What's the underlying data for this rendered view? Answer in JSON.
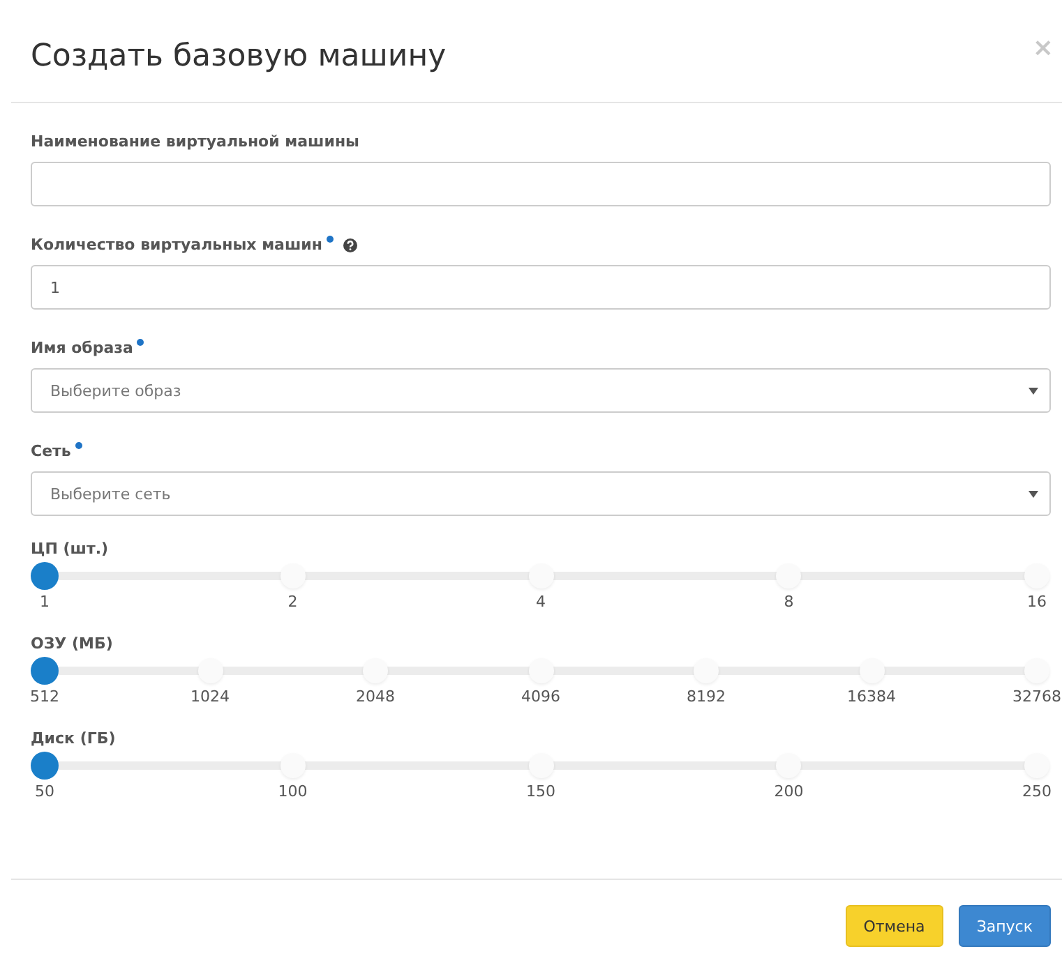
{
  "dialog": {
    "title": "Создать базовую машину",
    "close": "×"
  },
  "fields": [
    {
      "kind": "text",
      "label": "Наименование виртуальной машины",
      "required": false,
      "help": false
    },
    {
      "kind": "text",
      "label": "Количество виртуальных машин",
      "required": true,
      "help": true,
      "value": "1"
    },
    {
      "kind": "select",
      "label": "Имя образа",
      "required": true,
      "help": false,
      "placeholder": "Выберите образ"
    },
    {
      "kind": "select",
      "label": "Сеть",
      "required": true,
      "help": false,
      "placeholder": "Выберите сеть"
    }
  ],
  "sliders": [
    {
      "label": "ЦП (шт.)",
      "level": 0,
      "ticks": [
        "1",
        "2",
        "4",
        "8",
        "16"
      ]
    },
    {
      "label": "ОЗУ (МБ)",
      "level": 0,
      "ticks": [
        "512",
        "1024",
        "2048",
        "4096",
        "8192",
        "16384",
        "32768"
      ]
    },
    {
      "label": "Диск (ГБ)",
      "level": 0,
      "ticks": [
        "50",
        "100",
        "150",
        "200",
        "250"
      ]
    }
  ],
  "buttons": [
    {
      "label": "Отмена",
      "kind": "cancel"
    },
    {
      "label": "Запуск",
      "kind": "primary"
    }
  ]
}
